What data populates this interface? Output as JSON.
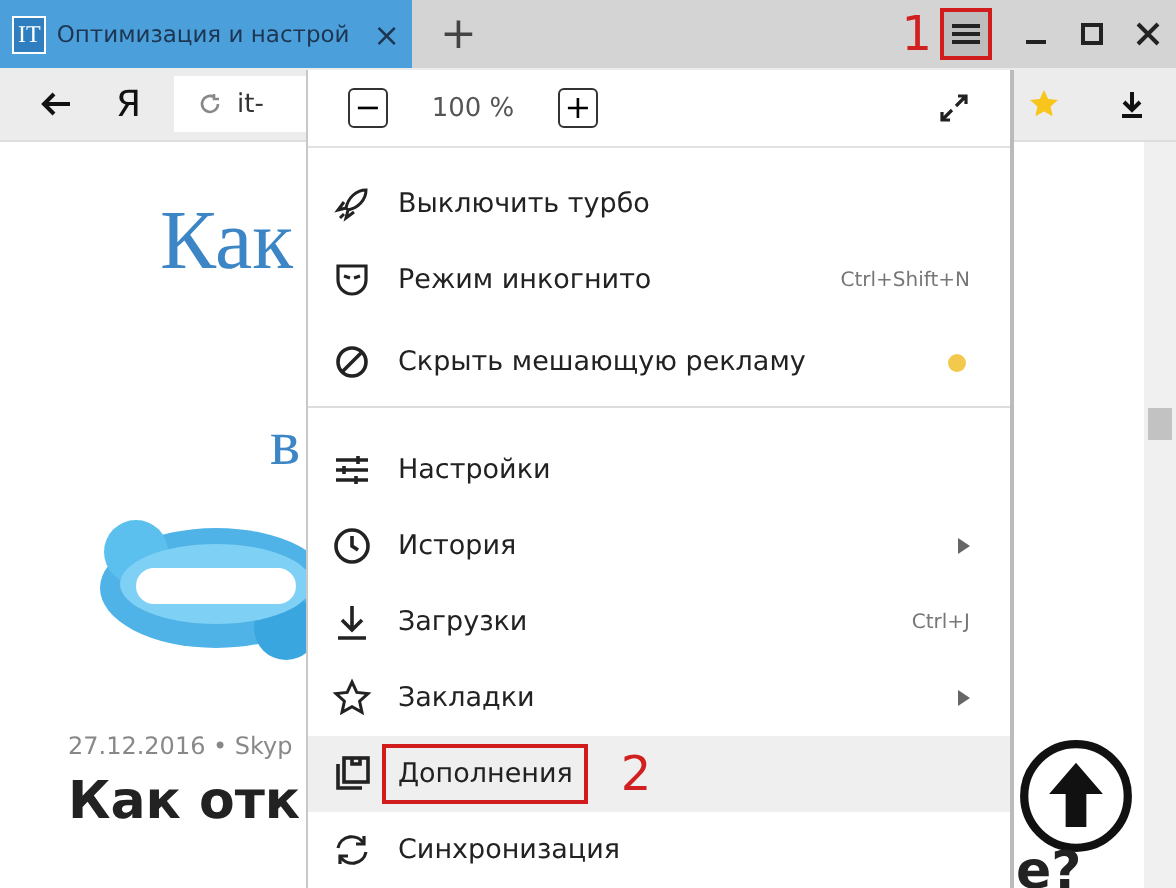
{
  "tab": {
    "favicon": "IT",
    "title": "Оптимизация и настрой",
    "close": "×",
    "new_tab": "+"
  },
  "toolbar": {
    "logo": "Я",
    "address": "it-"
  },
  "page": {
    "heading": "Как",
    "subheading": "в",
    "meta": "27.12.2016 • Skyp",
    "title_left": "Как отк",
    "title_right": "е?"
  },
  "menu": {
    "zoom": {
      "minus": "−",
      "value": "100 %",
      "plus": "+"
    },
    "items": [
      {
        "kind": "rocket",
        "label": "Выключить турбо",
        "separator_after": false,
        "submenu": false,
        "selected": false
      },
      {
        "kind": "mask",
        "label": "Режим инкогнито",
        "shortcut": "Ctrl+Shift+N",
        "separator_after": false,
        "submenu": false,
        "selected": false
      },
      {
        "kind": "block",
        "label": "Скрыть мешающую рекламу",
        "color": "#f2c94c",
        "separator_after": true,
        "submenu": false,
        "selected": false
      },
      {
        "kind": "sliders",
        "label": "Настройки",
        "separator_after": false,
        "submenu": false,
        "selected": false
      },
      {
        "kind": "clock",
        "label": "История",
        "separator_after": false,
        "submenu": true,
        "selected": false
      },
      {
        "kind": "download",
        "label": "Загрузки",
        "shortcut": "Ctrl+J",
        "separator_after": false,
        "submenu": false,
        "selected": false
      },
      {
        "kind": "star",
        "label": "Закладки",
        "separator_after": false,
        "submenu": true,
        "selected": false
      },
      {
        "kind": "addons",
        "label": "Дополнения",
        "separator_after": false,
        "submenu": false,
        "selected": true,
        "annotation": "2"
      },
      {
        "kind": "sync",
        "label": "Синхронизация",
        "separator_after": false,
        "submenu": false,
        "selected": false
      }
    ]
  },
  "menu_button_annotation": "1"
}
